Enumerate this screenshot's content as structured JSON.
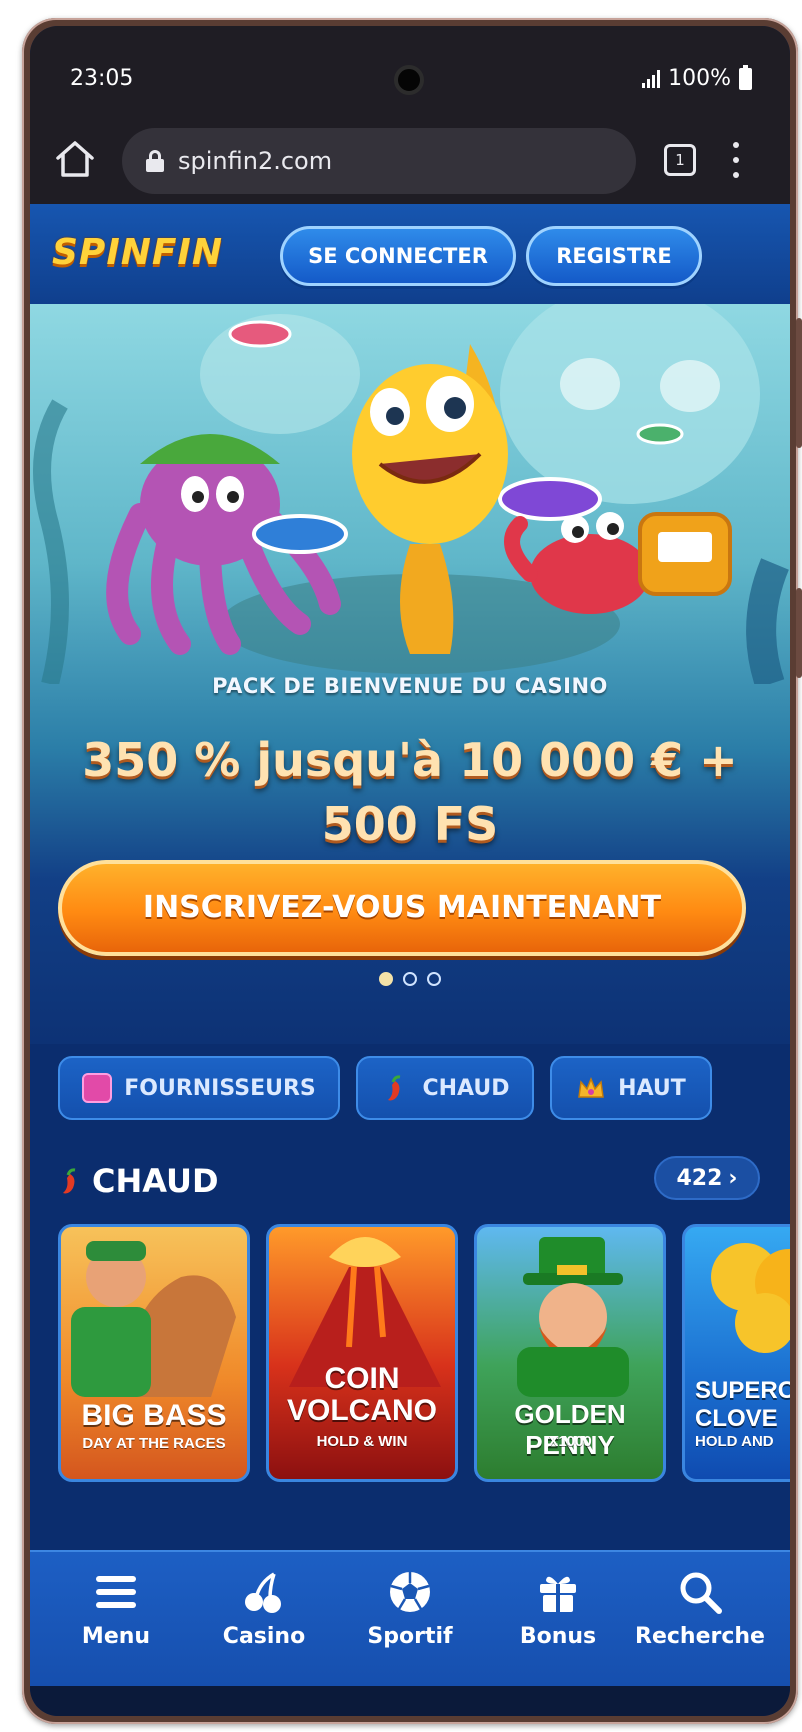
{
  "status_bar": {
    "time": "23:05",
    "battery": "100%"
  },
  "browser": {
    "url": "spinfin2.com",
    "tab_count": "1"
  },
  "header": {
    "logo": "SPINFIN",
    "login_label": "SE CONNECTER",
    "register_label": "REGISTRE"
  },
  "hero": {
    "subtitle": "PACK DE BIENVENUE DU CASINO",
    "title": "350 % jusqu'à 10 000 € + 500 FS",
    "cta_label": "INSCRIVEZ-VOUS MAINTENANT",
    "slides": 3,
    "active_slide": 1
  },
  "categories": [
    {
      "label": "FOURNISSEURS",
      "icon": "book-icon"
    },
    {
      "label": "CHAUD",
      "icon": "chili-icon"
    },
    {
      "label": "HAUT",
      "icon": "crown-icon"
    }
  ],
  "hot_section": {
    "title": "CHAUD",
    "count": "422",
    "games": [
      {
        "title": "BIG BASS",
        "subtitle": "DAY AT THE RACES"
      },
      {
        "title": "COIN VOLCANO",
        "subtitle": "HOLD & WIN"
      },
      {
        "title": "GOLDEN PENNY",
        "subtitle": "X1000"
      },
      {
        "title": "SUPERCH CLOVE",
        "subtitle": "HOLD AND"
      }
    ]
  },
  "bottom_nav": [
    {
      "label": "Menu",
      "icon": "hamburger-icon"
    },
    {
      "label": "Casino",
      "icon": "cherries-icon"
    },
    {
      "label": "Sportif",
      "icon": "soccer-ball-icon"
    },
    {
      "label": "Bonus",
      "icon": "gift-icon"
    },
    {
      "label": "Recherche",
      "icon": "search-icon"
    }
  ],
  "colors": {
    "brand_blue": "#1450ad",
    "cta_orange": "#ff8a12",
    "logo_yellow": "#ffd23a"
  }
}
